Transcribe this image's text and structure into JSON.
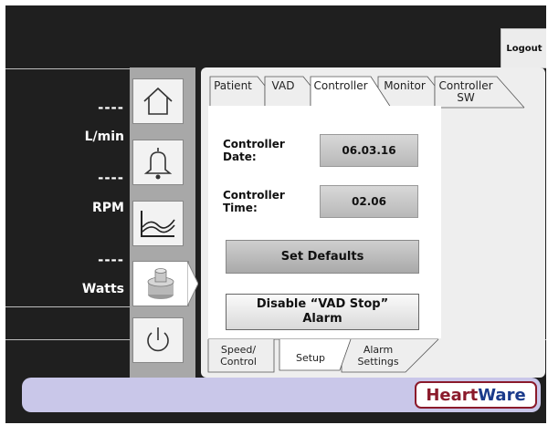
{
  "header": {
    "logout_label": "Logout"
  },
  "readouts": [
    {
      "value": "----",
      "unit": "L/min"
    },
    {
      "value": "----",
      "unit": "RPM"
    },
    {
      "value": "----",
      "unit": "Watts"
    }
  ],
  "nav": {
    "items": [
      {
        "icon": "home-icon"
      },
      {
        "icon": "bell-icon"
      },
      {
        "icon": "trend-graph-icon"
      },
      {
        "icon": "pump-icon",
        "active": true
      },
      {
        "icon": "power-icon"
      }
    ]
  },
  "tabs": {
    "top": [
      "Patient",
      "VAD",
      "Controller",
      "Monitor",
      "Controller SW"
    ],
    "active_top": "Controller",
    "bottom": [
      "Speed/ Control",
      "Setup",
      "Alarm Settings"
    ],
    "active_bottom": "Setup"
  },
  "controller": {
    "date_label": "Controller Date:",
    "date_value": "06.03.16",
    "time_label": "Controller Time:",
    "time_value": "02.06",
    "set_defaults_label": "Set Defaults",
    "disable_stop_label": "Disable “VAD Stop” Alarm"
  },
  "logo": {
    "part1": "Heart",
    "part2": "Ware",
    "color1": "#8b1a2b",
    "color2": "#1a3a8b"
  },
  "colors": {
    "background": "#1f1f1f",
    "nav": "#a8a8a8",
    "bar": "#c9c7e9"
  }
}
